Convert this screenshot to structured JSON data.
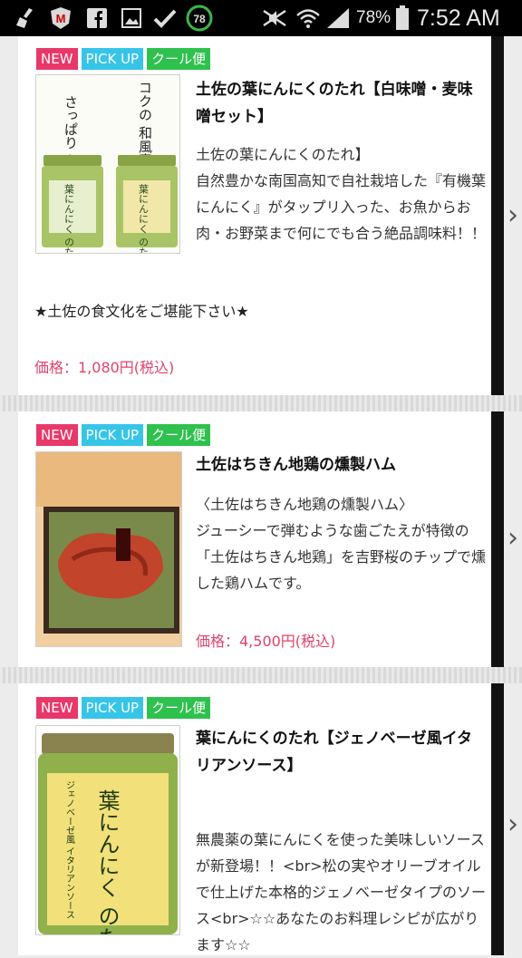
{
  "status_bar": {
    "battery": "78%",
    "time": "7:52 AM",
    "badge_number": "78",
    "app_letter": "M",
    "icons": [
      "broom-icon",
      "shield-icon",
      "facebook-icon",
      "gallery-icon",
      "check-icon",
      "circle-78-icon",
      "mute-icon",
      "wifi-icon",
      "signal-icon",
      "battery-icon"
    ]
  },
  "products": [
    {
      "badges": [
        "NEW",
        "PICK UP",
        "クール便"
      ],
      "title": "土佐の葉にんにくのたれ【白味噌・麦味噌セット】",
      "description": "土佐の葉にんにくのたれ】\n自然豊かな南国高知で自社栽培した『有機葉にんにく』がタップリ入った、お魚からお肉・お野菜まで何にでも合う絶品調味料！！",
      "extra": "★土佐の食文化をご堪能下さい★",
      "price": "価格：1,080円(税込)",
      "image": {
        "type": "two-jars",
        "left_text": "さっぱり\n和風白味噌",
        "right_text": "コクの\n和風麦味噌",
        "jar_label": "葉にんにく\nのたれ"
      }
    },
    {
      "badges": [
        "NEW",
        "PICK UP",
        "クール便"
      ],
      "title": "土佐はちきん地鶏の燻製ハム",
      "description": "〈土佐はちきん地鶏の燻製ハム〉\nジューシーで弾むような歯ごたえが特徴の「土佐はちきん地鶏」を吉野桜のチップで燻した鶏ハムです。",
      "price": "価格：4,500円(税込)",
      "image": {
        "type": "smoked-ham"
      }
    },
    {
      "badges": [
        "NEW",
        "PICK UP",
        "クール便"
      ],
      "title": "葉にんにくのたれ【ジェノベーゼ風イタリアンソース】",
      "description": "無農薬の葉にんにくを使った美味しいソースが新登場！！<br>松の実やオリーブオイルで仕上げた本格的ジェノベーゼタイプのソース<br>☆☆あなたのお料理レシピが広がります☆☆",
      "image": {
        "type": "single-jar",
        "label_main": "葉にんにく\nのたれ",
        "label_side": "ジェノベーゼ風\nイタリアンソース"
      }
    }
  ],
  "colors": {
    "new_badge": "#e8386a",
    "pickup_badge": "#36c5e8",
    "cool_badge": "#2fc14e",
    "price": "#e0426c"
  }
}
